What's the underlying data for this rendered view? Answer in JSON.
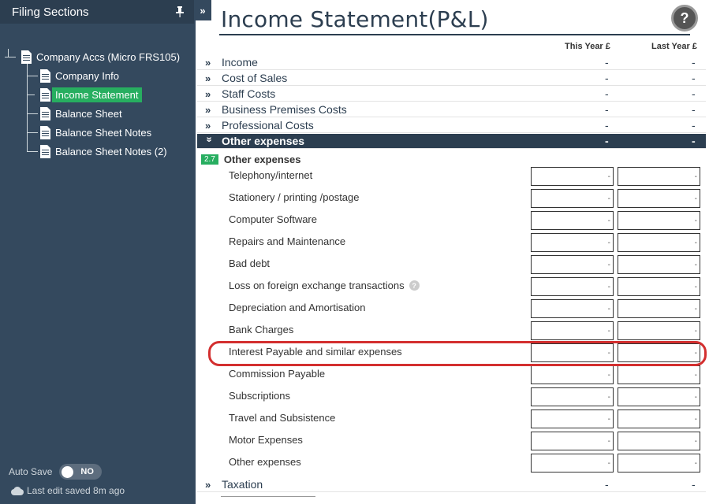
{
  "sidebar": {
    "title": "Filing Sections",
    "tree": {
      "root": "Company Accs (Micro FRS105)",
      "children": [
        {
          "label": "Company Info",
          "active": false
        },
        {
          "label": "Income Statement",
          "active": true
        },
        {
          "label": "Balance Sheet",
          "active": false
        },
        {
          "label": "Balance Sheet Notes",
          "active": false
        },
        {
          "label": "Balance Sheet Notes (2)",
          "active": false
        }
      ]
    },
    "autosave": {
      "label": "Auto Save",
      "toggle": "NO"
    },
    "last_edit": "Last edit saved 8m ago"
  },
  "collapse_label": "»",
  "main": {
    "title": "Income Statement(P&L)",
    "help": "?",
    "columns": {
      "this_year": "This Year £",
      "last_year": "Last Year £"
    },
    "sections": [
      {
        "title": "Income",
        "v1": "-",
        "v2": "-"
      },
      {
        "title": "Cost of Sales",
        "v1": "-",
        "v2": "-"
      },
      {
        "title": "Staff Costs",
        "v1": "-",
        "v2": "-"
      },
      {
        "title": "Business Premises Costs",
        "v1": "-",
        "v2": "-"
      },
      {
        "title": "Professional Costs",
        "v1": "-",
        "v2": "-"
      },
      {
        "title": "Other expenses",
        "v1": "-",
        "v2": "-"
      }
    ],
    "subsection": {
      "badge": "2.7",
      "title": "Other expenses"
    },
    "lines": [
      {
        "label": "Telephony/internet",
        "this_year": "-",
        "last_year": "-"
      },
      {
        "label": "Stationery / printing /postage",
        "this_year": "-",
        "last_year": "-"
      },
      {
        "label": "Computer Software",
        "this_year": "-",
        "last_year": "-"
      },
      {
        "label": "Repairs and Maintenance",
        "this_year": "-",
        "last_year": "-"
      },
      {
        "label": "Bad debt",
        "this_year": "-",
        "last_year": "-"
      },
      {
        "label": "Loss on foreign exchange transactions",
        "this_year": "-",
        "last_year": "-",
        "help": "?"
      },
      {
        "label": "Depreciation and Amortisation",
        "this_year": "-",
        "last_year": "-"
      },
      {
        "label": "Bank Charges",
        "this_year": "-",
        "last_year": "-"
      },
      {
        "label": "Interest Payable and similar expenses",
        "this_year": "-",
        "last_year": "-"
      },
      {
        "label": "Commission Payable",
        "this_year": "-",
        "last_year": "-"
      },
      {
        "label": "Subscriptions",
        "this_year": "-",
        "last_year": "-"
      },
      {
        "label": "Travel and Subsistence",
        "this_year": "-",
        "last_year": "-"
      },
      {
        "label": "Motor Expenses",
        "this_year": "-",
        "last_year": "-"
      },
      {
        "label": "Other expenses",
        "this_year": "-",
        "last_year": "-"
      }
    ],
    "after_sections": [
      {
        "title": "Taxation",
        "v1": "-",
        "v2": "-"
      }
    ]
  },
  "colors": {
    "sidebar": "#34495e",
    "accent": "#27ae60",
    "highlight": "#d32f2f",
    "heading": "#2c3e50"
  }
}
